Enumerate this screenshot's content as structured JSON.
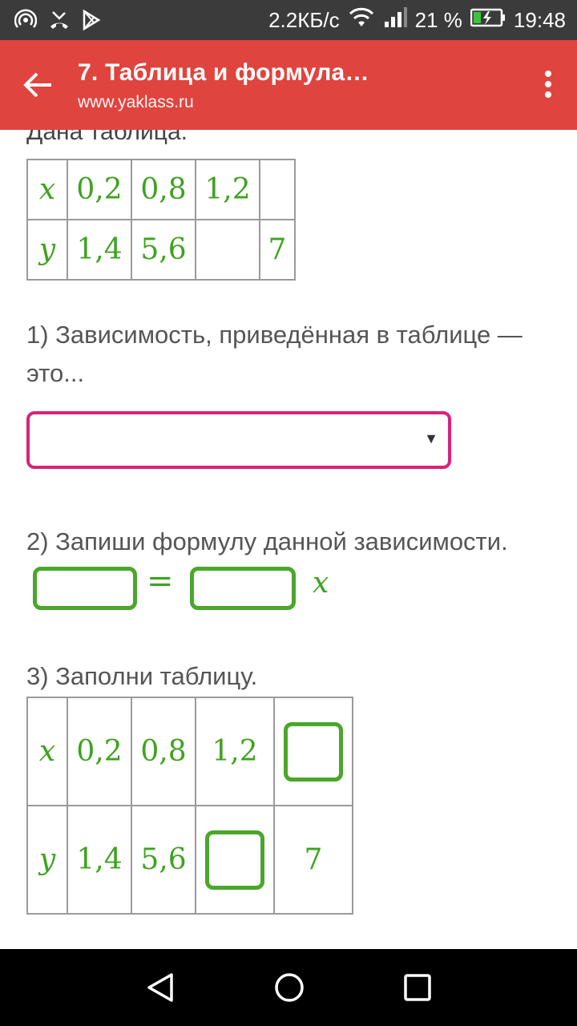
{
  "status_bar": {
    "speed": "2.2КБ/с",
    "battery": "21 %",
    "time": "19:48"
  },
  "app_bar": {
    "title": "7. Таблица и формула…",
    "url": "www.yaklass.ru"
  },
  "content": {
    "intro": "Дана таблица.",
    "table1": {
      "rows": [
        [
          "x",
          "0,2",
          "0,8",
          "1,2",
          ""
        ],
        [
          "y",
          "1,4",
          "5,6",
          "",
          "7"
        ]
      ]
    },
    "question1": "1) Зависимость, приведённая в таблице — это...",
    "question1_select_value": "",
    "question2": "2) Запиши формулу данной зависимости.",
    "formula": {
      "equals": "=",
      "variable": "x",
      "left_value": "",
      "right_value": ""
    },
    "question3": "3) Заполни таблицу.",
    "table2": {
      "row_x": [
        "x",
        "0,2",
        "0,8",
        "1,2"
      ],
      "row_y": [
        "y",
        "1,4",
        "5,6",
        "7"
      ]
    }
  },
  "icons": [
    "hotspot-icon",
    "missed-call-icon",
    "play-store-icon",
    "wifi-icon",
    "signal-icon",
    "battery-charging-icon",
    "back-arrow-icon",
    "more-vert-icon",
    "nav-back-icon",
    "nav-home-icon",
    "nav-recents-icon"
  ],
  "colors": {
    "app_bar": "#e0443e",
    "accent_green": "#3fa220",
    "select_border": "#d6247a"
  }
}
